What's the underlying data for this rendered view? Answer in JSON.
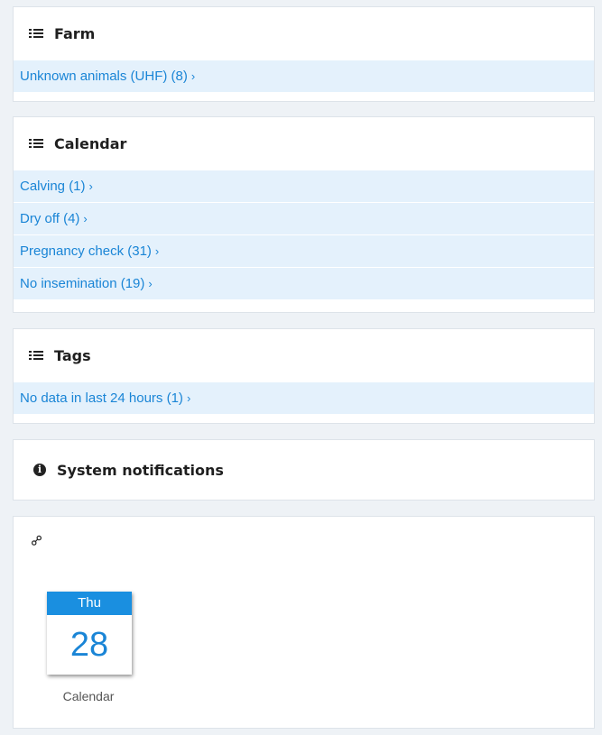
{
  "farm": {
    "title": "Farm",
    "items": [
      {
        "label": "Unknown animals (UHF) (8)",
        "chevron": "›"
      }
    ]
  },
  "calendar": {
    "title": "Calendar",
    "items": [
      {
        "label": "Calving (1)",
        "chevron": "›"
      },
      {
        "label": "Dry off (4)",
        "chevron": "›"
      },
      {
        "label": "Pregnancy check (31)",
        "chevron": "›"
      },
      {
        "label": "No insemination (19)",
        "chevron": "›"
      }
    ]
  },
  "tags": {
    "title": "Tags",
    "items": [
      {
        "label": "No data in last 24 hours (1)",
        "chevron": "›"
      }
    ]
  },
  "system": {
    "title": "System notifications",
    "icon_glyph": "i"
  },
  "shortcuts": {
    "link_glyph": "⚯",
    "calendar_tile": {
      "day": "Thu",
      "date": "28",
      "label": "Calendar"
    }
  },
  "icons": {
    "list": "list-icon",
    "info": "info-icon",
    "link": "link-icon"
  },
  "colors": {
    "accent": "#1a85d6",
    "item_bg": "#e4f1fc",
    "page_bg": "#eef2f6",
    "calendar_header": "#1a8fe0"
  }
}
